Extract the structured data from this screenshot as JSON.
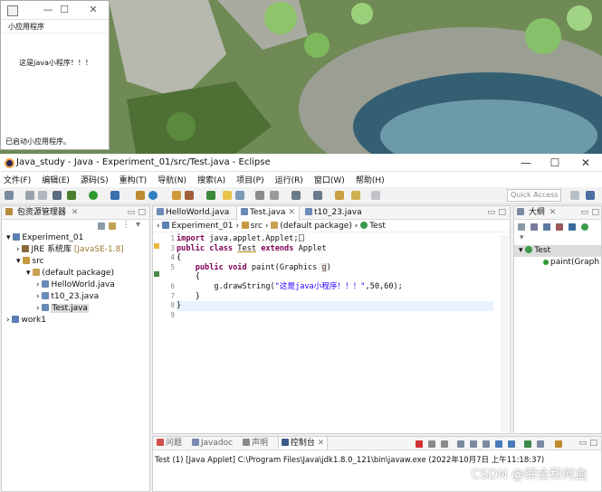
{
  "applet": {
    "menu": "小应用程序",
    "text": "这是java小程序！！！",
    "status": "已启动小应用程序。"
  },
  "window": {
    "title": "Java_study - Java - Experiment_01/src/Test.java - Eclipse"
  },
  "menubar": [
    "文件(F)",
    "编辑(E)",
    "源码(S)",
    "重构(T)",
    "导航(N)",
    "搜索(A)",
    "项目(P)",
    "运行(R)",
    "窗口(W)",
    "帮助(H)"
  ],
  "toolbar": {
    "quick_access": "Quick Access"
  },
  "explorer": {
    "title": "包资源管理器",
    "items": [
      {
        "label": "Experiment_01",
        "level": 0,
        "open": true,
        "kind": "project"
      },
      {
        "label": "JRE 系统库",
        "suffix": "[JavaSE-1.8]",
        "level": 1,
        "open": false,
        "kind": "lib"
      },
      {
        "label": "src",
        "level": 1,
        "open": true,
        "kind": "src"
      },
      {
        "label": "(default package)",
        "level": 2,
        "open": true,
        "kind": "pkg"
      },
      {
        "label": "HelloWorld.java",
        "level": 3,
        "open": false,
        "kind": "java"
      },
      {
        "label": "t10_23.java",
        "level": 3,
        "open": false,
        "kind": "java"
      },
      {
        "label": "Test.java",
        "level": 3,
        "open": false,
        "kind": "java",
        "selected": true
      },
      {
        "label": "work1",
        "level": 0,
        "open": false,
        "kind": "project"
      }
    ]
  },
  "editor": {
    "tabs": [
      {
        "label": "HelloWorld.java",
        "active": false
      },
      {
        "label": "Test.java",
        "active": true
      },
      {
        "label": "t10_23.java",
        "active": false
      }
    ],
    "breadcrumb": [
      "Experiment_01",
      "src",
      "(default package)",
      "Test"
    ],
    "line_numbers": [
      "1",
      "3",
      "4",
      "5",
      "6",
      "7",
      "8",
      "9"
    ],
    "code": {
      "l1_kw": "import",
      "l1_rest": " java.applet.Applet;",
      "l3_kw1": "public",
      "l3_kw2": "class",
      "l3_name": "Test",
      "l3_kw3": "extends",
      "l3_base": "Applet",
      "l4": "{",
      "l5_kw1": "public",
      "l5_kw2": "void",
      "l5_rest": " paint(Graphics ",
      "l5_param": "g",
      "l5_end": ")",
      "l6": "{",
      "l7_pre": "g.drawString(",
      "l7_str": "\"这是java小程序！！！\"",
      "l7_post": ",50,60);",
      "l8": "}",
      "l9": "}"
    }
  },
  "outline": {
    "title": "大纲",
    "items": [
      "Test",
      "paint(Graph"
    ]
  },
  "console": {
    "tabs": [
      "问题",
      "Javadoc",
      "声明",
      "控制台"
    ],
    "line": "Test (1)   [Java Applet] C:\\Program Files\\Java\\jdk1.8.0_121\\bin\\javaw.exe  (2022年10月7日 上午11:18:37)"
  },
  "watermark": "CSDN @综合和何盒"
}
